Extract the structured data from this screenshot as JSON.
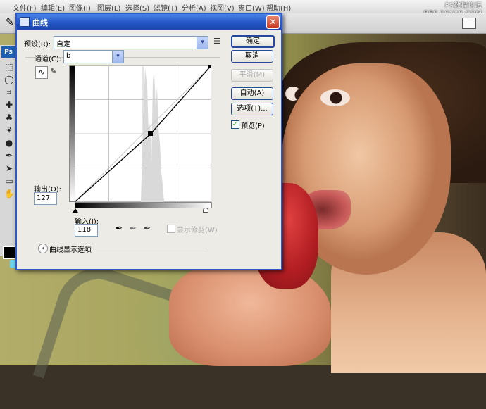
{
  "menubar": {
    "items": [
      "文件(F)",
      "编辑(E)",
      "图像(I)",
      "图层(L)",
      "选择(S)",
      "滤镜(T)",
      "分析(A)",
      "视图(V)",
      "窗口(W)",
      "帮助(H)"
    ],
    "watermark_line1": "PS教程论坛",
    "watermark_line2": "BBS.16XX8.COM"
  },
  "toolbar": {
    "logo": "Ps"
  },
  "dialog": {
    "title": "曲线",
    "close_glyph": "✕",
    "preset_label": "预设(R):",
    "preset_value": "自定",
    "channel_label": "通道(C):",
    "channel_value": "b",
    "output_label": "输出(O):",
    "output_value": "127",
    "input_label": "输入(I):",
    "input_value": "118",
    "show_clipping_label": "显示修剪(W)",
    "show_clipping_checked": false,
    "curve_display_options_label": "曲线显示选项",
    "buttons": {
      "ok": "确定",
      "cancel": "取消",
      "smooth": "平滑(M)",
      "auto": "自动(A)",
      "options": "选项(T)..."
    },
    "preview_label": "预览(P)",
    "preview_checked": true
  },
  "icons": {
    "dropdown": "▾",
    "check": "✓",
    "expander": "»",
    "curve_mode": "curve-point-icon",
    "pencil_mode": "pencil-icon",
    "black_point": "black-eyedropper-icon",
    "gray_point": "gray-eyedropper-icon",
    "white_point": "white-eyedropper-icon"
  }
}
